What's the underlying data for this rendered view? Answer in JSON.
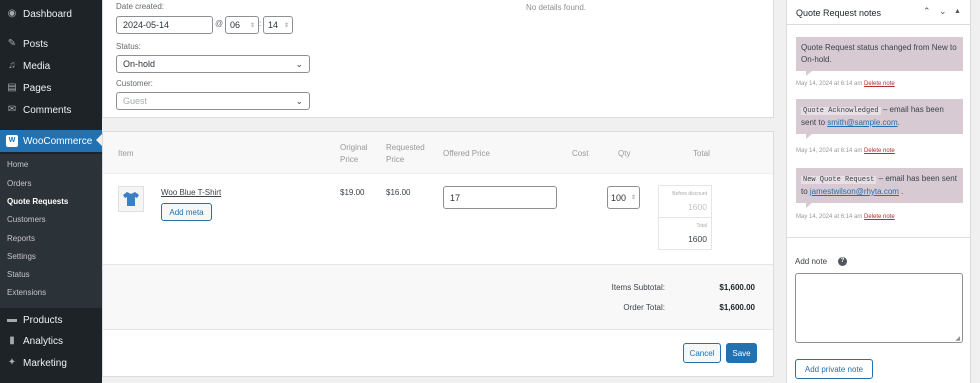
{
  "sidebar": {
    "top_items": [
      {
        "label": "Dashboard",
        "icon": "dashboard-icon",
        "glyph": "◉"
      },
      {
        "label": "Posts",
        "icon": "pin-icon",
        "glyph": "✎"
      },
      {
        "label": "Media",
        "icon": "media-icon",
        "glyph": "♫"
      },
      {
        "label": "Pages",
        "icon": "pages-icon",
        "glyph": "▤"
      },
      {
        "label": "Comments",
        "icon": "comments-icon",
        "glyph": "✉"
      }
    ],
    "woocommerce": {
      "label": "WooCommerce",
      "icon": "woo-icon",
      "glyph": "W"
    },
    "submenu": [
      "Home",
      "Orders",
      "Quote Requests",
      "Customers",
      "Reports",
      "Settings",
      "Status",
      "Extensions"
    ],
    "submenu_active": "Quote Requests",
    "bottom_items": [
      {
        "label": "Products",
        "icon": "products-icon",
        "glyph": "▬"
      },
      {
        "label": "Analytics",
        "icon": "analytics-icon",
        "glyph": "▮"
      },
      {
        "label": "Marketing",
        "icon": "megaphone-icon",
        "glyph": "✦"
      }
    ]
  },
  "general": {
    "date_created_label": "Date created:",
    "date_value": "2024-05-14",
    "at_symbol": "@",
    "hour": "06",
    "minute": "14",
    "time_sep": ":",
    "status_label": "Status:",
    "status_value": "On-hold",
    "customer_label": "Customer:",
    "customer_placeholder": "Guest",
    "no_details": "No details found."
  },
  "items_table": {
    "headers": {
      "item": "Item",
      "original_price": "Original\nPrice",
      "requested_price": "Requested\nPrice",
      "offered_price": "Offered Price",
      "cost": "Cost",
      "qty": "Qty",
      "total": "Total"
    },
    "row": {
      "name": "Woo Blue T-Shirt",
      "add_meta": "Add meta",
      "original_price": "$19.00",
      "requested_price": "$16.00",
      "offered_price": "17",
      "qty": "100",
      "before_discount_label": "Before discount",
      "before_discount_value": "1600",
      "total_label": "Total",
      "total_value": "1600"
    },
    "totals": {
      "subtotal_label": "Items Subtotal:",
      "subtotal_value": "$1,600.00",
      "order_total_label": "Order Total:",
      "order_total_value": "$1,600.00"
    },
    "cancel_label": "Cancel",
    "save_label": "Save"
  },
  "notes": {
    "title": "Quote Request notes",
    "items": [
      {
        "text": "Quote Request status changed from New to On-hold.",
        "date": "May 14, 2024 at 6:14 am",
        "delete": "Delete note"
      },
      {
        "code": "Quote Acknowledged",
        "text": " – email has been sent to ",
        "email": "smith@sample.com",
        "tail": ".",
        "date": "May 14, 2024 at 6:14 am",
        "delete": "Delete note"
      },
      {
        "code": "New Quote Request",
        "text": " – email has been sent to ",
        "email": "jamestwilson@rhyta.com",
        "tail": " .",
        "date": "May 14, 2024 at 6:14 am",
        "delete": "Delete note"
      }
    ],
    "add_note_label": "Add note",
    "add_private_label": "Add private note"
  },
  "colors": {
    "accent": "#2271b1",
    "sidebar": "#1d2327",
    "note_bg": "#d7cad2"
  }
}
